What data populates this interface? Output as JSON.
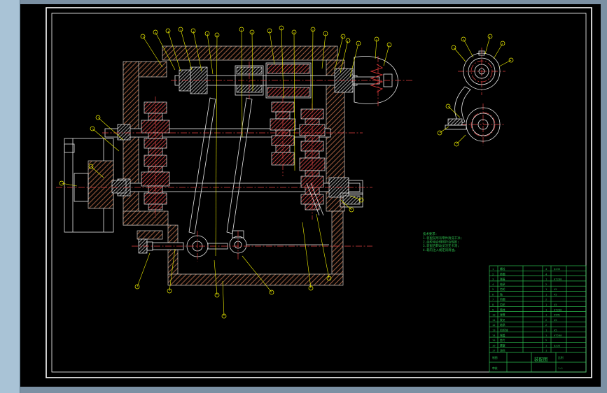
{
  "app": {
    "background_color": "#7b90a3",
    "left_strip_color": "#a9c3d6",
    "canvas_color": "#000000"
  },
  "colors": {
    "frame": "#ffffff",
    "housing_hatch": "#9a5a3c",
    "gear_hatch": "#cc4040",
    "centerline": "#e04040",
    "leader": "#f2f200",
    "annotation_green": "#2bbf4f"
  },
  "notes": {
    "title": "技术要求:",
    "lines": [
      "1.装配前所有零件清洗干净;",
      "2.齿轮啮合侧隙符合规定;",
      "3.装配后转动灵活无卡滞;",
      "4.箱内注入规定润滑油。"
    ]
  },
  "bom": {
    "rows": [
      [
        "1",
        "螺栓",
        "",
        "4",
        "Q235",
        ""
      ],
      [
        "2",
        "垫圈",
        "",
        "4",
        "",
        ""
      ],
      [
        "3",
        "端盖",
        "",
        "1",
        "HT200",
        ""
      ],
      [
        "4",
        "轴承",
        "",
        "2",
        "",
        ""
      ],
      [
        "5",
        "齿轮",
        "",
        "1",
        "45",
        ""
      ],
      [
        "6",
        "轴",
        "",
        "1",
        "45",
        ""
      ],
      [
        "7",
        "挡圈",
        "",
        "2",
        "",
        ""
      ],
      [
        "8",
        "齿轮",
        "",
        "1",
        "45",
        ""
      ],
      [
        "9",
        "箱体",
        "",
        "1",
        "HT200",
        ""
      ],
      [
        "10",
        "弹簧",
        "",
        "1",
        "65Mn",
        ""
      ],
      [
        "11",
        "拨叉",
        "",
        "2",
        "45",
        ""
      ],
      [
        "12",
        "轴承",
        "",
        "2",
        "",
        ""
      ],
      [
        "13",
        "齿轮轴",
        "",
        "1",
        "45",
        ""
      ],
      [
        "14",
        "端盖",
        "",
        "1",
        "HT200",
        ""
      ],
      [
        "15",
        "垫片",
        "",
        "2",
        "",
        ""
      ],
      [
        "16",
        "螺塞",
        "",
        "1",
        "Q235",
        ""
      ],
      [
        "17",
        "油标",
        "",
        "1",
        "",
        ""
      ]
    ],
    "title_block": {
      "cells": [
        {
          "label": "制图"
        },
        {
          "label": "审核"
        }
      ],
      "title": "装配图",
      "scale_label": "比例",
      "scale": "1:1"
    }
  }
}
